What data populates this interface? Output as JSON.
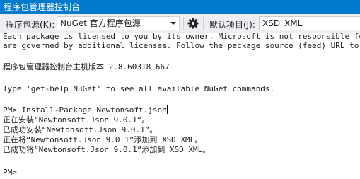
{
  "window": {
    "title": "程序包管理器控制台"
  },
  "toolbar": {
    "source_label": "程序包源(K):",
    "source_value": "NuGet 官方程序包源",
    "settings_icon": "gear-icon",
    "default_project_label": "默认项目(J):",
    "default_project_value": "XSD_XML"
  },
  "console": {
    "lines": [
      "Each package is licensed to you by its owner. Microsoft is not responsible for, nor does it grant any licenses to, third-party packages. Some packages may include dependencies which",
      "are governed by additional licenses. Follow the package source (feed) URL to determine any dependencies.",
      "程序包管理器控制台主机版本 2.8.60318.667",
      "Type 'get-help NuGet' to see all available NuGet commands.",
      "PM> Install-Package Newtonsoft.json",
      "正在安装“Newtonsoft.Json 9.0.1”。",
      "已成功安装“Newtonsoft.Json 9.0.1”。",
      "正在将“Newtonsoft.Json 9.0.1”添加到 XSD_XML。",
      "已成功将“Newtonsoft.Json 9.0.1”添加到 XSD_XML。",
      "PM>"
    ]
  }
}
